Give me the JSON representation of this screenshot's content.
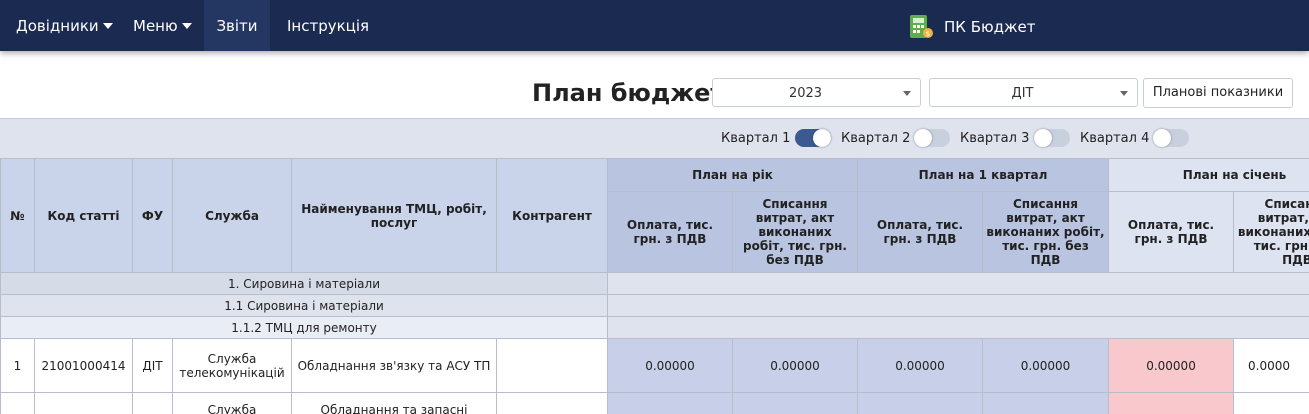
{
  "nav": {
    "directories": "Довідники",
    "menu": "Меню",
    "reports": "Звіти",
    "instruction": "Інструкція",
    "brand": "ПК Бюджет"
  },
  "controls": {
    "title": "План бюджету",
    "year": "2023",
    "department": "ДІТ",
    "plan_button": "Планові показники"
  },
  "quarters": [
    {
      "label": "Квартал 1",
      "on": true
    },
    {
      "label": "Квартал 2",
      "on": false
    },
    {
      "label": "Квартал 3",
      "on": false
    },
    {
      "label": "Квартал 4",
      "on": false
    }
  ],
  "table": {
    "headers": {
      "no": "№",
      "code": "Код статті",
      "fu": "ФУ",
      "service": "Служба",
      "name": "Найменування ТМЦ, робіт, послуг",
      "counterparty": "Контрагент",
      "plan_year": "План на рік",
      "plan_q1": "План на 1 квартал",
      "plan_jan": "План на січень",
      "pay": "Оплата, тис. грн. з ПДВ",
      "writeoff": "Списання витрат, акт виконаних робіт, тис. грн. без ПДВ"
    },
    "groups": [
      "1. Сировина і матеріали",
      "1.1 Сировина і матеріали",
      "1.1.2 ТМЦ для ремонту"
    ],
    "row1": {
      "no": "1",
      "code": "21001000414",
      "fu": "ДІТ",
      "service": "Служба телекомунікацій",
      "name": "Обладнання зв'язку та АСУ ТП",
      "counterparty": "",
      "values": [
        "0.00000",
        "0.00000",
        "0.00000",
        "0.00000",
        "0.00000",
        "0.0000"
      ]
    },
    "row2": {
      "service": "Служба",
      "name": "Обладнання та запасні"
    }
  },
  "colors": {
    "navbar": "#1b2a50",
    "toggle_on": "#3c5a91",
    "highlight_cell": "#f8c8cc"
  }
}
